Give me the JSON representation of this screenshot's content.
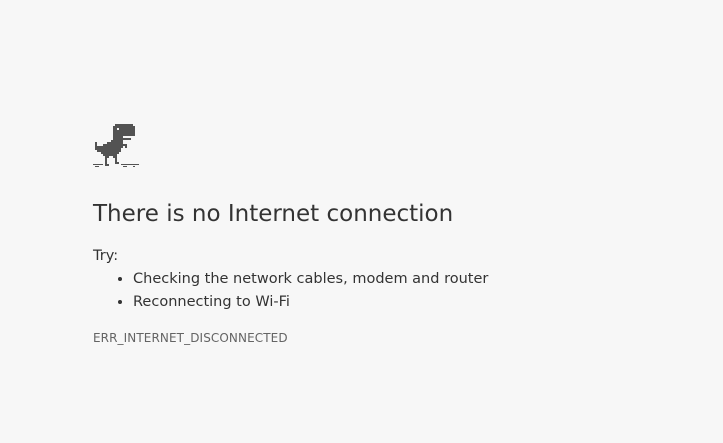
{
  "main_message": "There is no Internet connection",
  "suggestions": {
    "heading": "Try:",
    "items": [
      "Checking the network cables, modem and router",
      "Reconnecting to Wi-Fi"
    ]
  },
  "error_code": "ERR_INTERNET_DISCONNECTED",
  "icon": "offline-dino-icon",
  "colors": {
    "background": "#f7f7f7",
    "text": "#333333",
    "error_code": "#646464",
    "dino": "#535353"
  }
}
